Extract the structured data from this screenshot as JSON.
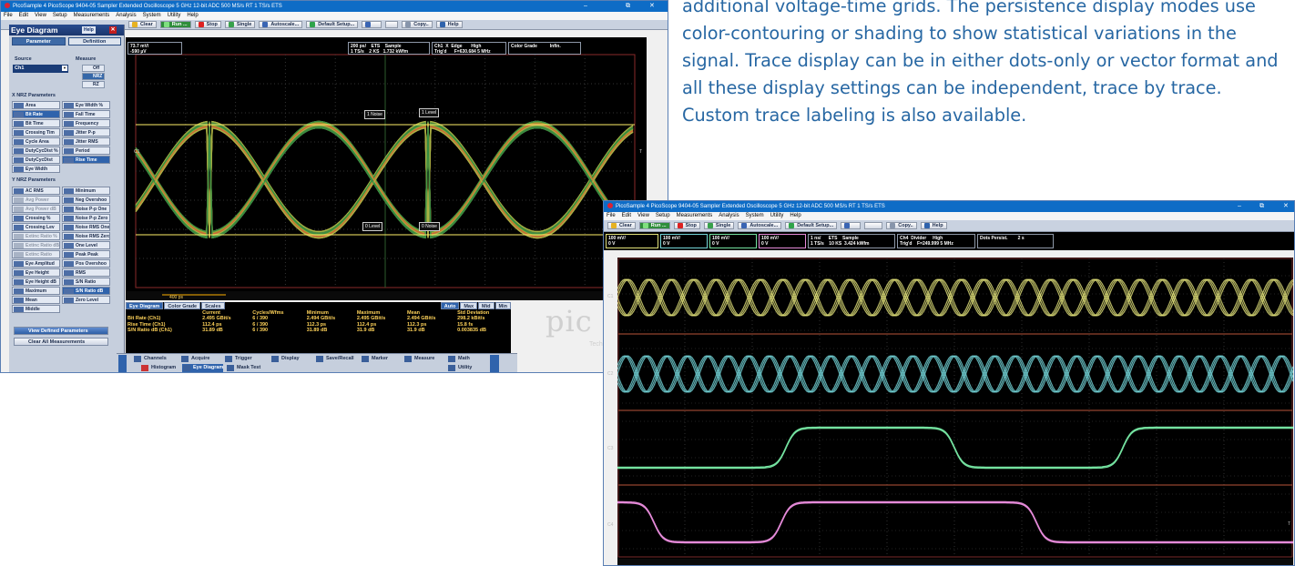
{
  "intro_text": "additional voltage-time grids. The persistence display modes use color-contouring or shading to show statistical variations in the signal. Trace display can be in either dots-only or vector format and all these display settings can be independent, trace by trace. Custom trace labeling is also available.",
  "colors": {
    "accent_text": "#2767a3",
    "trace_yellow": "#e2e27a",
    "trace_cyan": "#73d5d8",
    "trace_green": "#74e2a0",
    "trace_pink": "#e58ad9"
  },
  "window1": {
    "title": "PicoSample 4  PicoScope 9404-05  Sampler Extended Oscilloscope  5 GHz  12-bit ADC  500 MS/s RT  1 TS/s ETS",
    "window_controls": {
      "minimize": "–",
      "maximize": "⧉",
      "close": "✕"
    },
    "menu": [
      "File",
      "Edit",
      "View",
      "Setup",
      "Measurements",
      "Analysis",
      "System",
      "Utility",
      "Help"
    ],
    "toolbar": {
      "clear": "Clear",
      "run": "Run ...",
      "stop": "Stop",
      "single": "Single",
      "autoscale": "Autoscale...",
      "default_setup": "Default Setup...",
      "copy": "Copy..",
      "help": "Help"
    },
    "info": {
      "ch_scale": "73.7 mV/\n-590 µV",
      "timebase": "200 ps/    ETS    Sample\n1 TS/s    2 KS   1.732 kWfm",
      "trigger": "Ch1  X  Edge       High\nTrig'd      F=630.684 5 MHz",
      "display": "Color Grade          Infin."
    },
    "panel": {
      "title": "Eye Diagram",
      "help": "Help",
      "tab_parameter": "Parameter",
      "tab_definition": "Definition",
      "source_label": "Source",
      "source_value": "Ch1",
      "measure_label": "Measure",
      "measure_off": "Off",
      "measure_nrz": "NRZ",
      "measure_rz": "RZ",
      "x_section": "X NRZ Parameters",
      "x_params": [
        {
          "label": "Area",
          "state": "normal"
        },
        {
          "label": "Eye Width %",
          "state": "normal"
        },
        {
          "label": "Bit Rate",
          "state": "sel"
        },
        {
          "label": "Fall Time",
          "state": "normal"
        },
        {
          "label": "Bit Time",
          "state": "normal"
        },
        {
          "label": "Frequency",
          "state": "normal"
        },
        {
          "label": "Crossing Tim",
          "state": "normal"
        },
        {
          "label": "Jitter P-p",
          "state": "normal"
        },
        {
          "label": "Cycle Area",
          "state": "normal"
        },
        {
          "label": "Jitter RMS",
          "state": "normal"
        },
        {
          "label": "DutyCycDist %",
          "state": "normal"
        },
        {
          "label": "Period",
          "state": "normal"
        },
        {
          "label": "DutyCycDist",
          "state": "normal"
        },
        {
          "label": "Rise Time",
          "state": "sel"
        },
        {
          "label": "Eye Width",
          "state": "normal"
        }
      ],
      "y_section": "Y NRZ Parameters",
      "y_params": [
        {
          "label": "AC RMS",
          "state": "normal"
        },
        {
          "label": "Minimum",
          "state": "normal"
        },
        {
          "label": "Avg Power",
          "state": "dis"
        },
        {
          "label": "Neg Overshoo",
          "state": "normal"
        },
        {
          "label": "Avg Power dB",
          "state": "dis"
        },
        {
          "label": "Noise P-p One",
          "state": "normal"
        },
        {
          "label": "Crossing %",
          "state": "normal"
        },
        {
          "label": "Noise P-p Zero",
          "state": "normal"
        },
        {
          "label": "Crossing Lev",
          "state": "normal"
        },
        {
          "label": "Noise RMS One",
          "state": "normal"
        },
        {
          "label": "Extinc Ratio %",
          "state": "dis"
        },
        {
          "label": "Noise RMS Zero",
          "state": "normal"
        },
        {
          "label": "Extinc Ratio dB",
          "state": "dis"
        },
        {
          "label": "One Level",
          "state": "normal"
        },
        {
          "label": "Extinc Ratio",
          "state": "dis"
        },
        {
          "label": "Peak Peak",
          "state": "normal"
        },
        {
          "label": "Eye Amplitud",
          "state": "normal"
        },
        {
          "label": "Pos Overshoo",
          "state": "normal"
        },
        {
          "label": "Eye Height",
          "state": "normal"
        },
        {
          "label": "RMS",
          "state": "normal"
        },
        {
          "label": "Eye Height dB",
          "state": "normal"
        },
        {
          "label": "S/N Ratio",
          "state": "normal"
        },
        {
          "label": "Maximum",
          "state": "normal"
        },
        {
          "label": "S/N Ratio dB",
          "state": "sel"
        },
        {
          "label": "Mean",
          "state": "normal"
        },
        {
          "label": "Zero Level",
          "state": "normal"
        },
        {
          "label": "Middle",
          "state": "normal"
        }
      ],
      "view_defined": "View Defined Parameters",
      "clear_all": "Clear All Measurements"
    },
    "scope": {
      "ch_label": "C1",
      "t_label": "T",
      "time_marker": "400 ps",
      "labels": {
        "one_noise": "1 Noise",
        "one_level": "1 Level",
        "zero_level": "0 Level",
        "zero_noise": "0 Noise"
      }
    },
    "meas": {
      "tabs": [
        "Eye Diagram",
        "Color Grade",
        "Scales"
      ],
      "mode_tabs": [
        "Auto",
        "Max",
        "Mid",
        "Min"
      ],
      "headers": [
        "",
        "Current",
        "Cycles/Wfms",
        "Minimum",
        "Maximum",
        "Mean",
        "Std Deviation"
      ],
      "rows": [
        [
          "Bit Rate (Ch1)",
          "2.495 GBit/s",
          "6 / 390",
          "2.494 GBit/s",
          "2.495 GBit/s",
          "2.494 GBit/s",
          "298.2 kBit/s"
        ],
        [
          "Rise Time (Ch1)",
          "112.4 ps",
          "6 / 390",
          "112.3 ps",
          "112.4 ps",
          "112.3 ps",
          "15.8 fs"
        ],
        [
          "S/N Ratio dB (Ch1)",
          "31.89 dB",
          "6 / 390",
          "31.89 dB",
          "31.9 dB",
          "31.9 dB",
          "0.003835 dB"
        ]
      ]
    },
    "bottom": {
      "channels": "Channels",
      "acquire": "Acquire",
      "trigger": "Trigger",
      "display": "Display",
      "save_recall": "Save/Recall",
      "marker": "Marker",
      "measure": "Measure",
      "math": "Math",
      "histogram": "Histogram",
      "eye_diagram": "Eye Diagram",
      "mask_test": "Mask Test",
      "utility": "Utility"
    },
    "logo": "pic",
    "logo_sub": "Tech"
  },
  "window2": {
    "title": "PicoSample 4  PicoScope 9404-05  Sampler Extended Oscilloscope  5 GHz  12-bit ADC  500 MS/s RT  1 TS/s ETS",
    "window_controls": {
      "minimize": "–",
      "maximize": "⧉",
      "close": "✕"
    },
    "menu": [
      "File",
      "Edit",
      "View",
      "Setup",
      "Measurements",
      "Analysis",
      "System",
      "Utility",
      "Help"
    ],
    "toolbar": {
      "clear": "Clear",
      "run": "Run ...",
      "stop": "Stop",
      "single": "Single",
      "autoscale": "Autoscale...",
      "default_setup": "Default Setup...",
      "copy": "Copy..",
      "help": "Help"
    },
    "info": {
      "ch1": "100 mV/\n0 V",
      "ch2": "100 mV/\n0 V",
      "ch3": "100 mV/\n0 V",
      "ch4": "100 mV/\n0 V",
      "timebase": "1 ns/      ETS    Sample\n1 TS/s    10 KS  3.424 kWfm",
      "trigger": "Ch4  Divider     High\nTrig'd    F=249.999 5 MHz",
      "display": "Dots Persist.        2 s"
    },
    "scope": {
      "c1": "C1",
      "c2": "C2",
      "c3": "C3",
      "c4": "C4",
      "t": "T"
    }
  }
}
